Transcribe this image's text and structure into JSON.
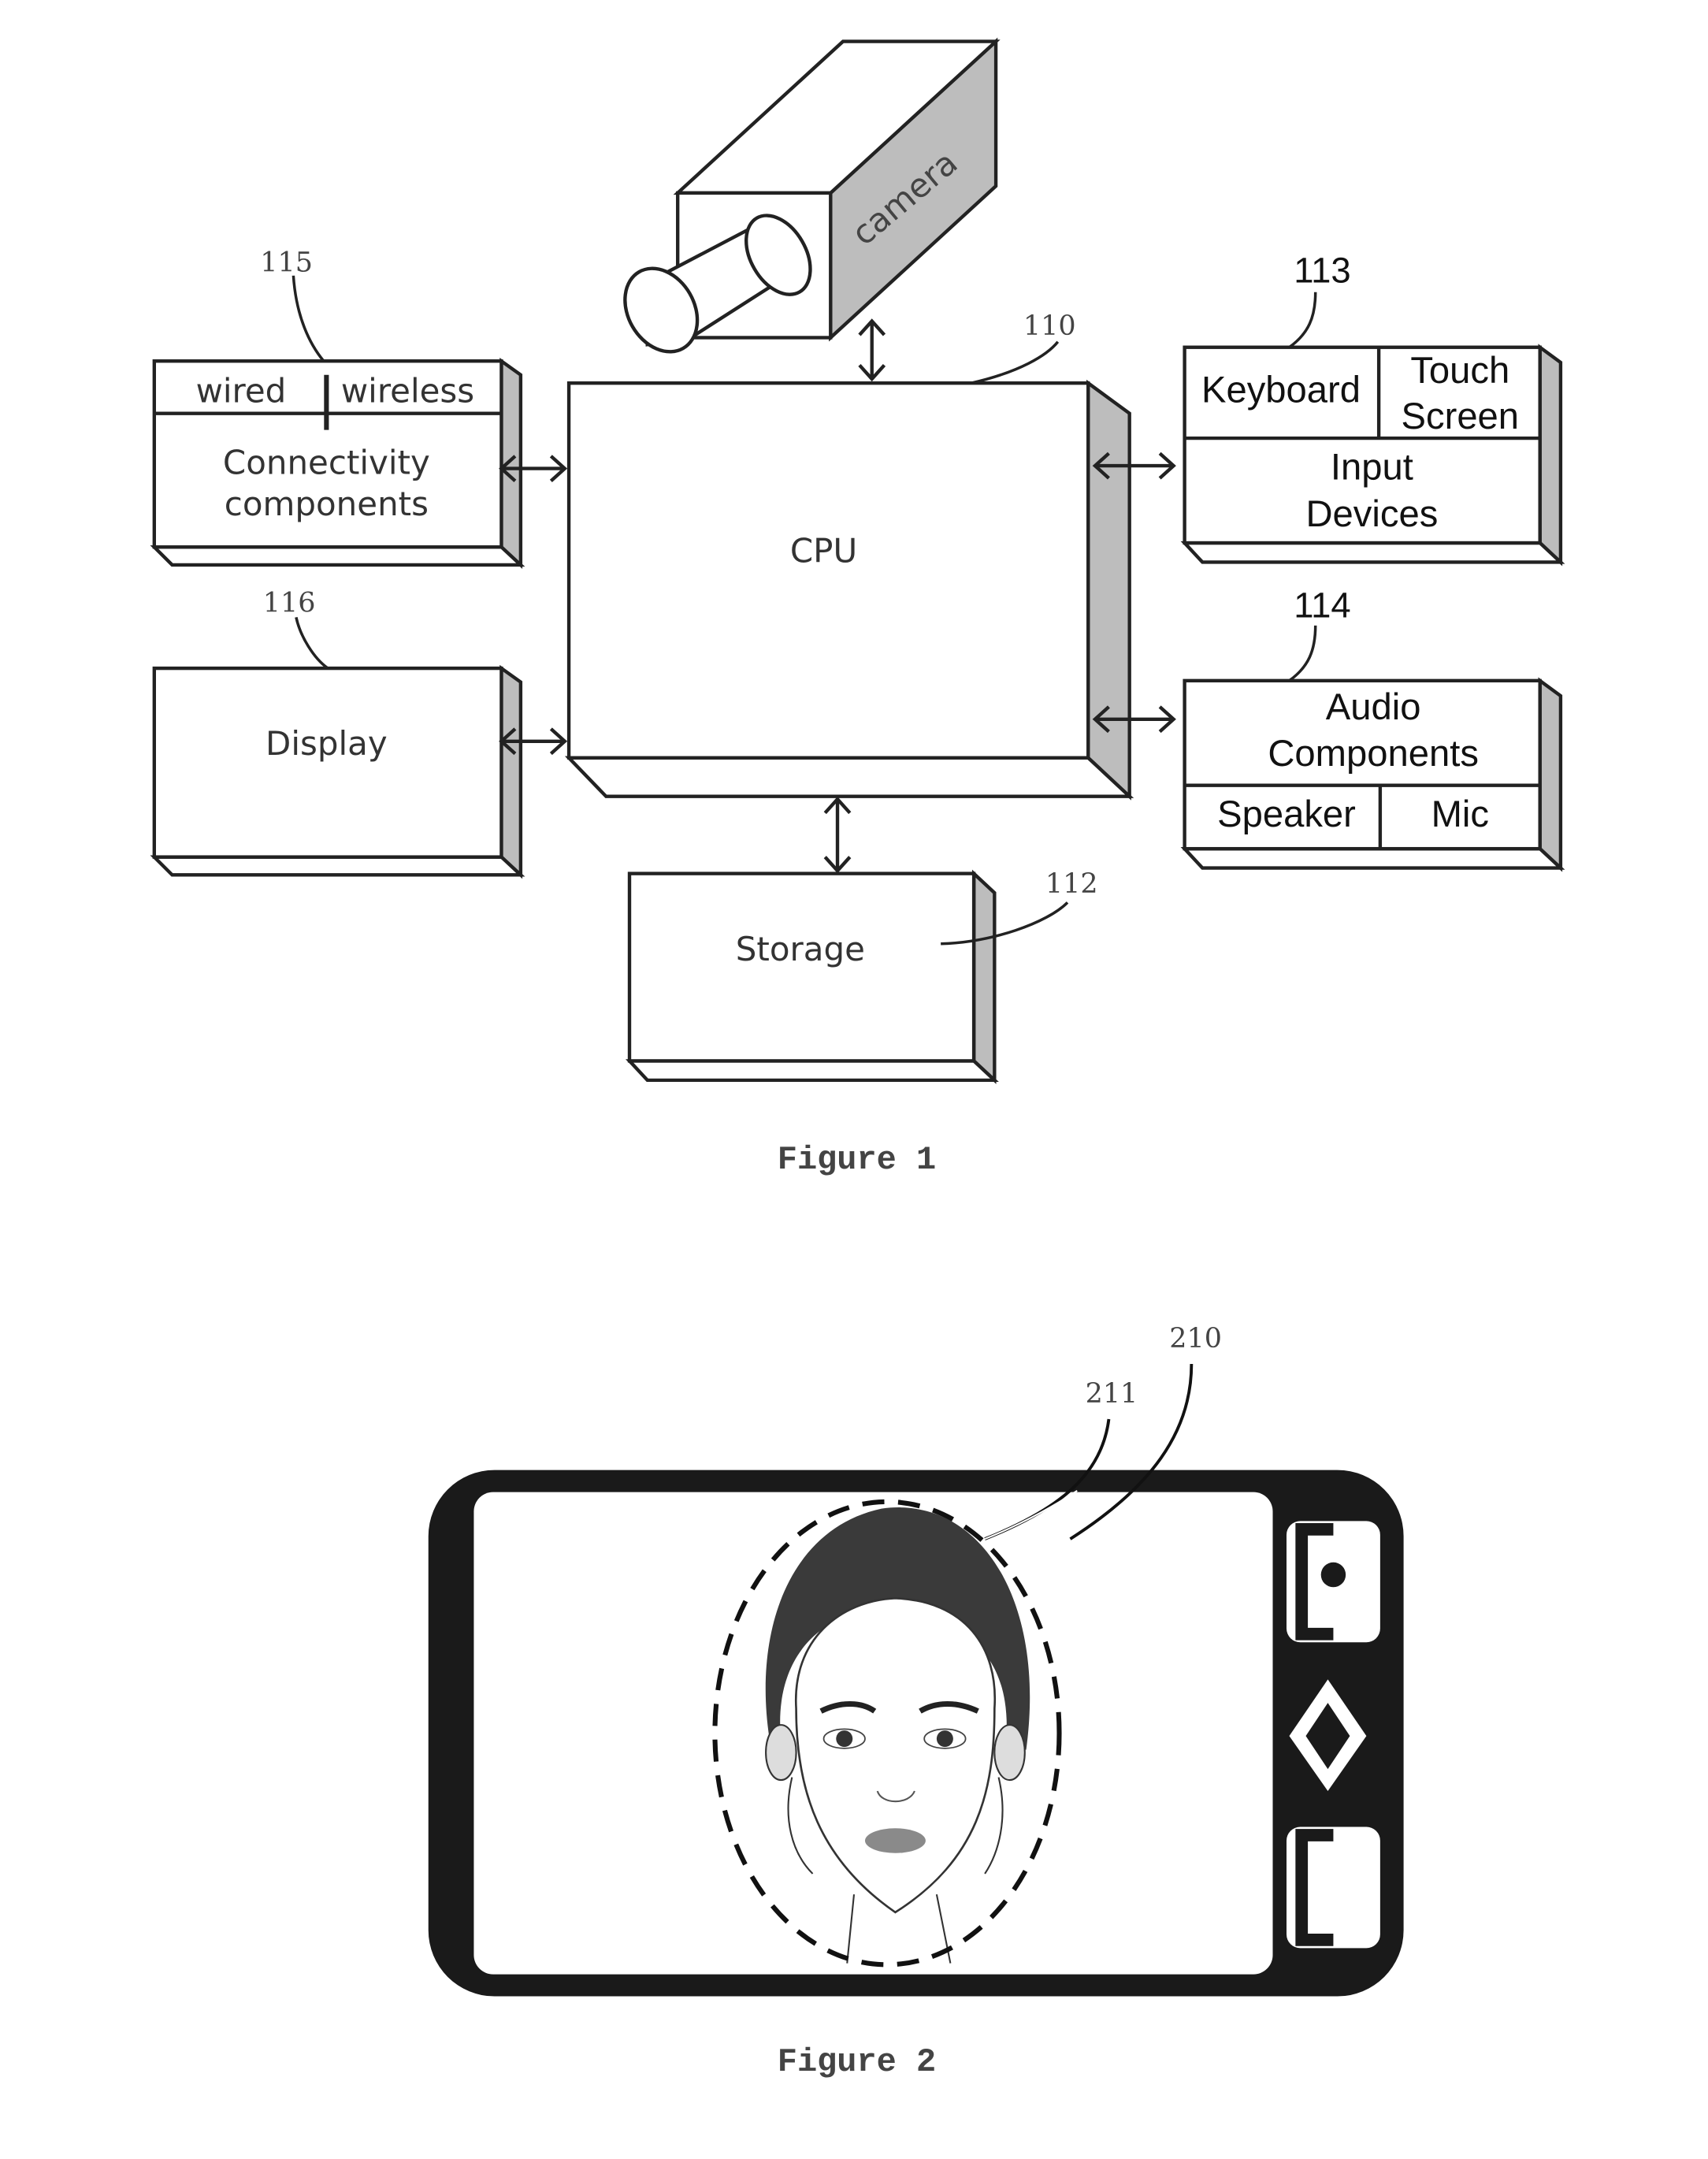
{
  "figure1": {
    "caption": "Figure 1",
    "camera": {
      "label": "camera"
    },
    "cpu": {
      "label": "CPU",
      "ref": "110"
    },
    "connectivity": {
      "ref": "115",
      "sub_left": "wired",
      "sub_right": "wireless",
      "line1": "Connectivity",
      "line2": "components"
    },
    "display": {
      "ref": "116",
      "label": "Display"
    },
    "storage": {
      "ref": "112",
      "label": "Storage"
    },
    "input_devices": {
      "ref": "113",
      "sub_left": "Keyboard",
      "sub_right_1": "Touch",
      "sub_right_2": "Screen",
      "line1": "Input",
      "line2": "Devices"
    },
    "audio": {
      "ref": "114",
      "line1": "Audio",
      "line2": "Components",
      "sub_left": "Speaker",
      "sub_right": "Mic"
    }
  },
  "figure2": {
    "caption": "Figure 2",
    "ref_screen": "210",
    "ref_face_outline": "211"
  }
}
